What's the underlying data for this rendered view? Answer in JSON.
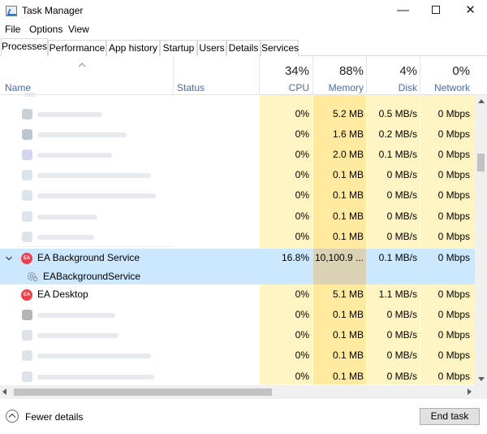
{
  "window": {
    "title": "Task Manager",
    "minimize_glyph": "—",
    "close_glyph": "✕"
  },
  "menu": {
    "items": [
      "File",
      "Options",
      "View"
    ]
  },
  "tabs": [
    "Processes",
    "Performance",
    "App history",
    "Startup",
    "Users",
    "Details",
    "Services"
  ],
  "active_tab": "Processes",
  "header": {
    "name_label": "Name",
    "status_label": "Status",
    "cpu": {
      "pct": "34%",
      "label": "CPU"
    },
    "memory": {
      "pct": "88%",
      "label": "Memory"
    },
    "disk": {
      "pct": "4%",
      "label": "Disk"
    },
    "network": {
      "pct": "0%",
      "label": "Network"
    }
  },
  "colors": {
    "cpu_col": "#fff4c4",
    "mem_col": "#ffeaa0",
    "disk_col": "#fff4c4",
    "net_col": "#fff4c4",
    "selected": "#cce8ff",
    "ea_red": "#ef3f4b"
  },
  "rows_top": [
    {
      "cpu": "0%",
      "memory": "5.2 MB",
      "disk": "0.5 MB/s",
      "network": "0 Mbps"
    },
    {
      "cpu": "0%",
      "memory": "1.6 MB",
      "disk": "0.2 MB/s",
      "network": "0 Mbps"
    },
    {
      "cpu": "0%",
      "memory": "2.0 MB",
      "disk": "0.1 MB/s",
      "network": "0 Mbps"
    },
    {
      "cpu": "0%",
      "memory": "0.1 MB",
      "disk": "0 MB/s",
      "network": "0 Mbps"
    },
    {
      "cpu": "0%",
      "memory": "0.1 MB",
      "disk": "0 MB/s",
      "network": "0 Mbps"
    },
    {
      "cpu": "0%",
      "memory": "0.1 MB",
      "disk": "0 MB/s",
      "network": "0 Mbps"
    },
    {
      "cpu": "0%",
      "memory": "0.1 MB",
      "disk": "0 MB/s",
      "network": "0 Mbps"
    }
  ],
  "ea_background": {
    "name": "EA Background Service",
    "icon_text": "EA",
    "child": "EABackgroundService",
    "cpu": "16.8%",
    "memory": "10,100.9 ...",
    "disk": "0.1 MB/s",
    "network": "0 Mbps"
  },
  "ea_desktop": {
    "name": "EA Desktop",
    "icon_text": "EA",
    "cpu": "0%",
    "memory": "5.1 MB",
    "disk": "1.1 MB/s",
    "network": "0 Mbps"
  },
  "rows_bottom": [
    {
      "cpu": "0%",
      "memory": "0.1 MB",
      "disk": "0 MB/s",
      "network": "0 Mbps"
    },
    {
      "cpu": "0%",
      "memory": "0.1 MB",
      "disk": "0 MB/s",
      "network": "0 Mbps"
    },
    {
      "cpu": "0%",
      "memory": "0.1 MB",
      "disk": "0 MB/s",
      "network": "0 Mbps"
    },
    {
      "cpu": "0%",
      "memory": "0.1 MB",
      "disk": "0 MB/s",
      "network": "0 Mbps"
    }
  ],
  "footer": {
    "fewer_details": "Fewer details",
    "end_task": "End task"
  }
}
